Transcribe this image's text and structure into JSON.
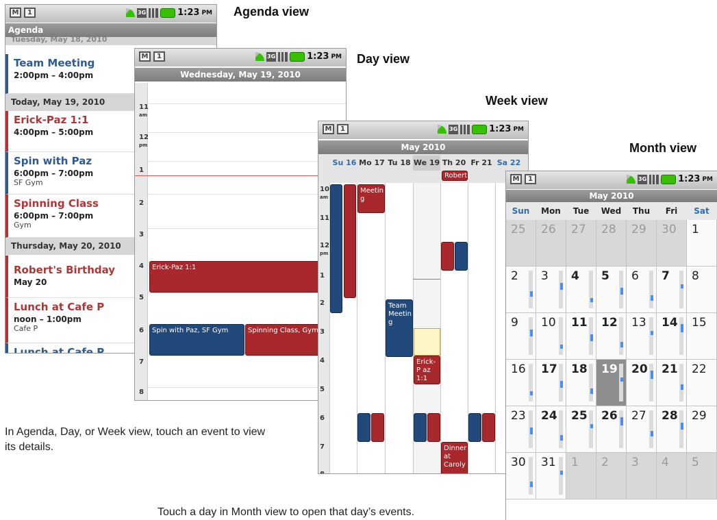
{
  "status_time": "1:23",
  "status_pm": "PM",
  "status_icons": [
    "gmail-icon",
    "calendar-icon",
    "sync-icon",
    "3g-icon",
    "signal-icon",
    "battery-icon"
  ],
  "captions": {
    "agenda": "Agenda view",
    "day": "Day view",
    "week": "Week view",
    "month": "Month view"
  },
  "notes": {
    "left": "In Agenda, Day, or Week view, touch an event to view its details.",
    "bottom": "Touch a day in Month view to open that day’s events."
  },
  "agenda": {
    "title": "Agenda",
    "prev_day": "Tuesday, May 18, 2010",
    "day1": "Today, May 19, 2010",
    "day2": "Thursday, May 20, 2010",
    "events": [
      {
        "title": "Team Meeting",
        "time": "2:00pm – 4:00pm",
        "loc": ""
      },
      {
        "title": "Erick-Paz 1:1",
        "time": "4:00pm – 5:00pm",
        "loc": ""
      },
      {
        "title": "Spin with Paz",
        "time": "6:00pm – 7:00pm",
        "loc": "SF Gym"
      },
      {
        "title": "Spinning Class",
        "time": "6:00pm – 7:00pm",
        "loc": "Gym"
      },
      {
        "title": "Robert's Birthday",
        "time": "May 20",
        "loc": ""
      },
      {
        "title": "Lunch at Cafe P",
        "time": "noon – 1:00pm",
        "loc": "Cafe P"
      },
      {
        "title": "Lunch at Cafe P",
        "time": "",
        "loc": ""
      }
    ]
  },
  "day": {
    "title": "Wednesday, May 19, 2010",
    "hours": [
      "11",
      "am",
      "12",
      "pm",
      "1",
      "2",
      "3",
      "4",
      "5",
      "6",
      "7",
      "8"
    ],
    "events": {
      "erick": "Erick-Paz 1:1",
      "spin": "Spin with Paz, SF Gym",
      "spinning": "Spinning Class, Gym"
    }
  },
  "week": {
    "title": "May 2010",
    "days": [
      "Su 16",
      "Mo 17",
      "Tu 18",
      "We 19",
      "Th 20",
      "Fr 21",
      "Sa 22"
    ],
    "allday": "Robert",
    "hours": [
      "10",
      "am",
      "11",
      "12",
      "pm",
      "1",
      "2",
      "3",
      "4",
      "5",
      "6",
      "7",
      "8"
    ],
    "events": {
      "meeting": "Meetin g",
      "team": "Team Meetin g",
      "erick": "Erick-P az 1:1",
      "dinner": "Dinner at Caroly"
    }
  },
  "month": {
    "title": "May 2010",
    "weekdays": [
      "Sun",
      "Mon",
      "Tue",
      "Wed",
      "Thu",
      "Fri",
      "Sat"
    ],
    "weeks": [
      [
        "25",
        "26",
        "27",
        "28",
        "29",
        "30",
        "1"
      ],
      [
        "2",
        "3",
        "4",
        "5",
        "6",
        "7",
        "8"
      ],
      [
        "9",
        "10",
        "11",
        "12",
        "13",
        "14",
        "15"
      ],
      [
        "16",
        "17",
        "18",
        "19",
        "20",
        "21",
        "22"
      ],
      [
        "23",
        "24",
        "25",
        "26",
        "27",
        "28",
        "29"
      ],
      [
        "30",
        "31",
        "1",
        "2",
        "3",
        "4",
        "5"
      ]
    ],
    "selected": "19"
  },
  "colors": {
    "blue": "#22497c",
    "red": "#a8282c",
    "accent": "#4a8ef2"
  }
}
